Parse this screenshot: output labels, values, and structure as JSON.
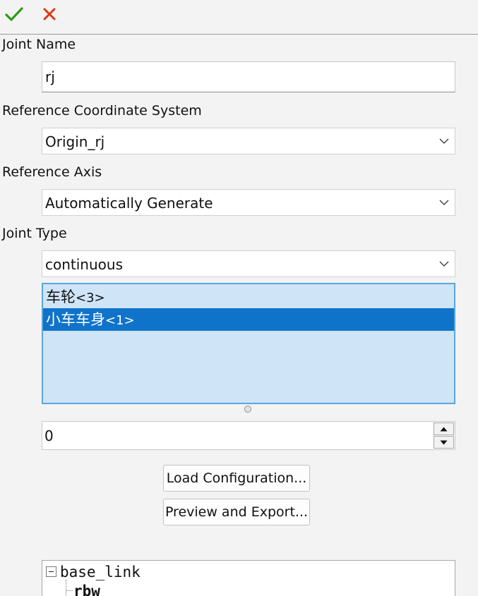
{
  "toolbar": {
    "ok_icon": "checkmark-icon",
    "cancel_icon": "close-icon",
    "ok_color": "#2e9a1a",
    "cancel_color": "#d63a14"
  },
  "joint_name": {
    "label": "Joint Name",
    "value": "rj"
  },
  "reference_coordinate_system": {
    "label": "Reference Coordinate System",
    "value": "Origin_rj"
  },
  "reference_axis": {
    "label": "Reference Axis",
    "value": "Automatically Generate"
  },
  "joint_type": {
    "label": "Joint Type",
    "value": "continuous"
  },
  "component_list": {
    "items": [
      {
        "name": "车轮",
        "suffix": "<3>",
        "selected": false
      },
      {
        "name": "小车车身",
        "suffix": "<1>",
        "selected": true
      }
    ],
    "background": "#cfe4f7",
    "selected_color": "#0f73c9"
  },
  "value_spinbox": {
    "value": "0"
  },
  "buttons": {
    "load_configuration": "Load Configuration...",
    "preview_and_export": "Preview and Export..."
  },
  "tree": {
    "root_label": "base_link",
    "root_expanded": true,
    "children": [
      "rbw"
    ]
  }
}
